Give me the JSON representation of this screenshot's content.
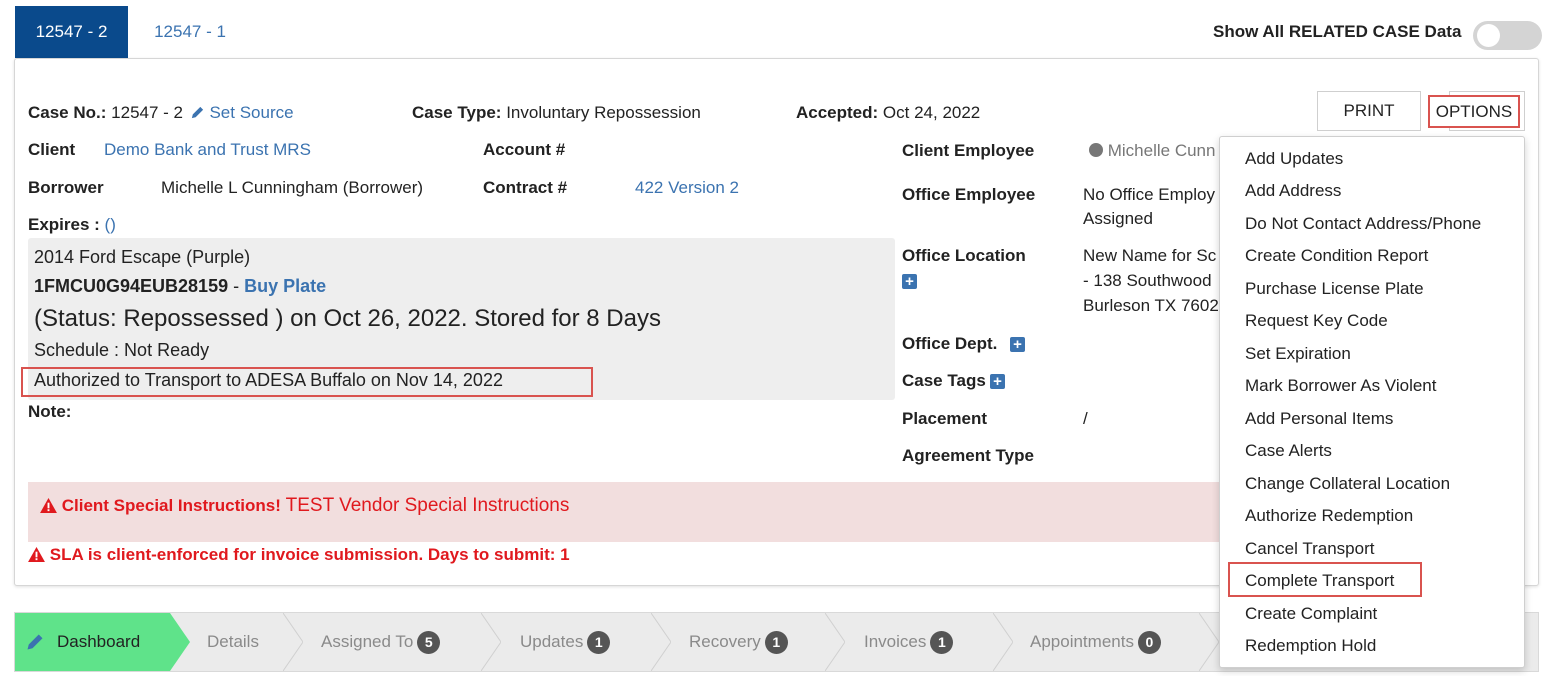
{
  "tabs": [
    {
      "label": "12547 - 2",
      "active": true
    },
    {
      "label": "12547 - 1",
      "active": false
    }
  ],
  "toggle": {
    "label": "Show All RELATED CASE Data",
    "on": false
  },
  "case": {
    "case_no_label": "Case No.:",
    "case_no": "12547 - 2",
    "set_source": "Set Source",
    "case_type_label": "Case Type:",
    "case_type": "Involuntary Repossession",
    "accepted_label": "Accepted:",
    "accepted": "Oct 24, 2022",
    "client_label": "Client",
    "client": "Demo Bank and Trust MRS",
    "account_label": "Account #",
    "borrower_label": "Borrower",
    "borrower": "Michelle L Cunningham (Borrower)",
    "contract_label": "Contract #",
    "contract": "422 Version 2",
    "expires_label": "Expires :",
    "expires": "()",
    "note_label": "Note:"
  },
  "vehicle": {
    "description": "2014 Ford Escape (Purple)",
    "vin": "1FMCU0G94EUB28159",
    "separator": "-",
    "buy_plate": "Buy Plate",
    "status": "(Status: Repossessed ) on Oct 26, 2022. Stored for 8 Days",
    "schedule": "Schedule : Not Ready",
    "transport": "Authorized to Transport to ADESA Buffalo on Nov 14, 2022"
  },
  "right_info": {
    "client_employee_label": "Client Employee",
    "client_employee": "Michelle Cunn",
    "office_employee_label": "Office Employee",
    "office_employee_line1": "No Office Employ",
    "office_employee_line2": "Assigned",
    "office_location_label": "Office Location",
    "office_location_line1": "New Name for Sc",
    "office_location_line2": "- 138 Southwood",
    "office_location_line3": "Burleson TX 7602",
    "office_dept_label": "Office Dept.",
    "case_tags_label": "Case Tags",
    "placement_label": "Placement",
    "placement": "/",
    "agreement_type_label": "Agreement Type"
  },
  "alerts": {
    "client_instructions_label": "Client Special Instructions!",
    "client_instructions": "TEST Vendor Special Instructions",
    "sla": "SLA is client-enforced for invoice submission. Days to submit: 1"
  },
  "buttons": {
    "print": "PRINT",
    "options": "OPTIONS"
  },
  "options_menu": [
    "Add Updates",
    "Add Address",
    "Do Not Contact Address/Phone",
    "Create Condition Report",
    "Purchase License Plate",
    "Request Key Code",
    "Set Expiration",
    "Mark Borrower As Violent",
    "Add Personal Items",
    "Case Alerts",
    "Change Collateral Location",
    "Authorize Redemption",
    "Cancel Transport",
    "Complete Transport",
    "Create Complaint",
    "Redemption Hold"
  ],
  "wizard": [
    {
      "label": "Dashboard",
      "badge": ""
    },
    {
      "label": "Details",
      "badge": ""
    },
    {
      "label": "Assigned To",
      "badge": "5"
    },
    {
      "label": "Updates",
      "badge": "1"
    },
    {
      "label": "Recovery",
      "badge": "1"
    },
    {
      "label": "Invoices",
      "badge": "1"
    },
    {
      "label": "Appointments",
      "badge": "0"
    }
  ],
  "colors": {
    "tab_active": "#0a4a8c",
    "link": "#3b73b0",
    "dashboard_step": "#5fe38a",
    "alert_bg": "#f2dede",
    "alert_text": "#e0191e",
    "highlight": "#d9534f"
  }
}
